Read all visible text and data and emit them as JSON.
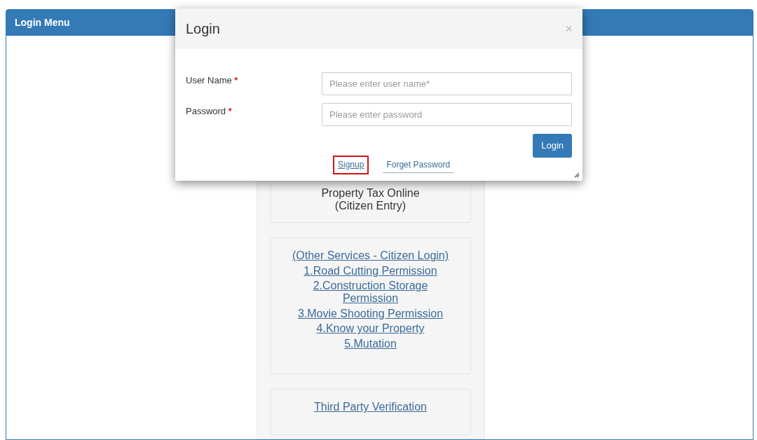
{
  "panel": {
    "title": "Login Menu"
  },
  "cards": [
    {
      "items": [
        {
          "kind": "text",
          "text": "Property Tax Online\n(Citizen Entry)"
        }
      ]
    },
    {
      "items": [
        {
          "kind": "link",
          "text": "(Other Services - Citizen Login)"
        },
        {
          "kind": "link",
          "text": "1.Road Cutting Permission"
        },
        {
          "kind": "link",
          "text": "2.Construction Storage\nPermission"
        },
        {
          "kind": "link",
          "text": "3.Movie Shooting Permission"
        },
        {
          "kind": "link",
          "text": "4.Know your Property"
        },
        {
          "kind": "link",
          "text": "5.Mutation"
        }
      ]
    },
    {
      "items": [
        {
          "kind": "link",
          "text": "Third Party Verification"
        }
      ]
    }
  ],
  "modal": {
    "title": "Login",
    "close": "×",
    "fields": [
      {
        "label": "User Name",
        "required_mark": "*",
        "placeholder": "Please enter user name*"
      },
      {
        "label": "Password",
        "required_mark": "*",
        "placeholder": "Please enter password"
      }
    ],
    "submit": "Login",
    "links": [
      {
        "text": "Signup",
        "highlighted": true
      },
      {
        "text": "Forget Password",
        "highlighted": false
      }
    ]
  }
}
